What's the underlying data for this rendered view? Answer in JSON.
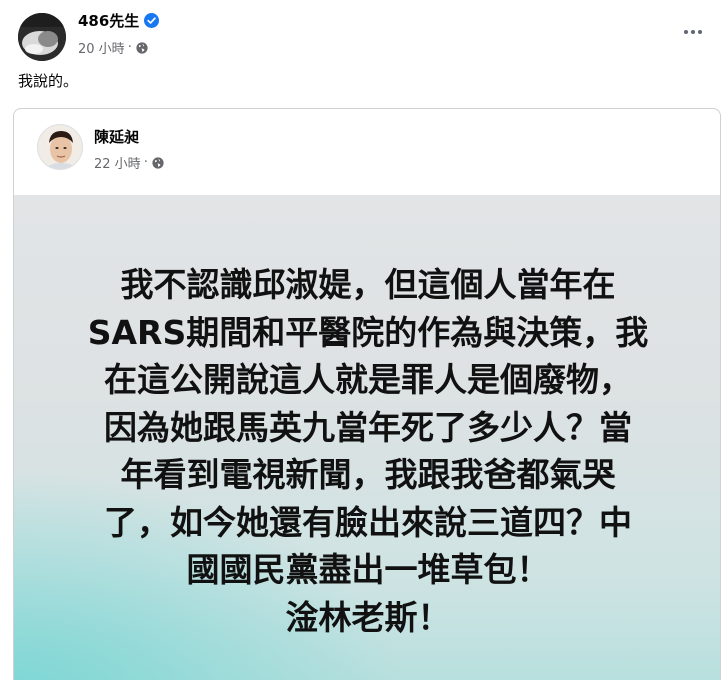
{
  "post": {
    "author": "486先生",
    "timestamp": "20 小時",
    "separator": "·",
    "text": "我說的。"
  },
  "shared": {
    "author": "陳延昶",
    "timestamp": "22 小時",
    "separator": "·",
    "body_lines": [
      "我不認識邱淑媞，但這個人當年在",
      "SARS期間和平醫院的作為與決策，我",
      "在這公開說這人就是罪人是個廢物，",
      "因為她跟馬英九當年死了多少人？當",
      "年看到電視新聞，我跟我爸都氣哭",
      "了，如今她還有臉出來說三道四？中",
      "國國民黨盡出一堆草包！",
      "淦林老斯！"
    ]
  },
  "icons": {
    "verified": "verified-badge-icon",
    "privacy": "globe-icon",
    "more": "more-options-icon"
  },
  "colors": {
    "verified_blue": "#1877f2",
    "meta_gray": "#65676b",
    "card_border": "#ced0d4",
    "gradient_teal": "#78d6d4"
  }
}
